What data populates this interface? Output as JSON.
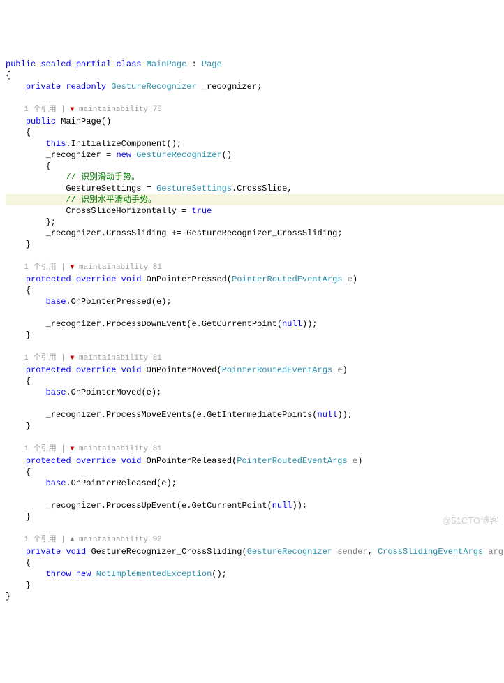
{
  "kw": {
    "public": "public",
    "sealed": "sealed",
    "partial": "partial",
    "class": "class",
    "private": "private",
    "readonly": "readonly",
    "this": "this",
    "new": "new",
    "true": "true",
    "protected": "protected",
    "override": "override",
    "void": "void",
    "base": "base",
    "null": "null",
    "throw": "throw"
  },
  "types": {
    "MainPage": "MainPage",
    "Page": "Page",
    "GestureRecognizer": "GestureRecognizer",
    "GestureSettings": "GestureSettings",
    "PointerRoutedEventArgs": "PointerRoutedEventArgs",
    "CrossSlidingEventArgs": "CrossSlidingEventArgs",
    "NotImplementedException": "NotImplementedException"
  },
  "ids": {
    "recognizer": "_recognizer",
    "InitializeComponent": "InitializeComponent",
    "CrossSlide": "CrossSlide",
    "CrossSlideHorizontally": "CrossSlideHorizontally",
    "CrossSliding": "CrossSliding",
    "handler": "GestureRecognizer_CrossSliding",
    "OnPointerPressed": "OnPointerPressed",
    "OnPointerMoved": "OnPointerMoved",
    "OnPointerReleased": "OnPointerReleased",
    "ProcessDownEvent": "ProcessDownEvent",
    "ProcessMoveEvents": "ProcessMoveEvents",
    "ProcessUpEvent": "ProcessUpEvent",
    "GetCurrentPoint": "GetCurrentPoint",
    "GetIntermediatePoints": "GetIntermediatePoints",
    "GestureSettingsProp": "GestureSettings",
    "e": "e",
    "sender": "sender",
    "args": "args"
  },
  "comments": {
    "slide": "// 识别滑动手势。",
    "hslide": "// 识别水平滑动手势。"
  },
  "codelens": {
    "refs": "1 个引用",
    "maint": "maintainability",
    "m75": "75",
    "m81": "81",
    "m92": "92"
  },
  "watermark": "@51CTO博客"
}
